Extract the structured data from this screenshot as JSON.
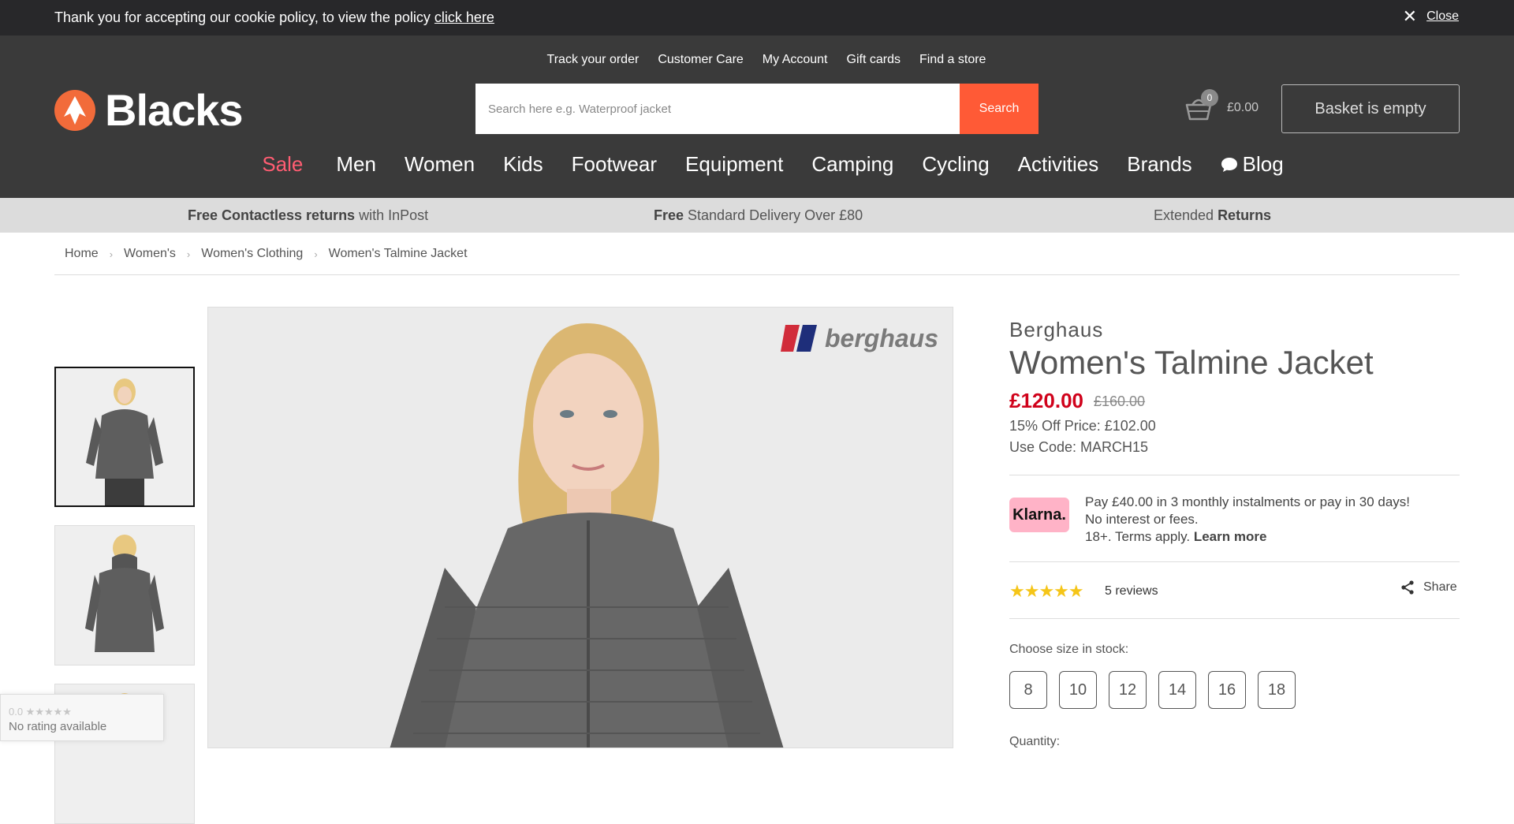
{
  "cookie": {
    "text": "Thank you for accepting our cookie policy, to view the policy ",
    "link": "click here",
    "close": "Close"
  },
  "util_nav": [
    "Track your order",
    "Customer Care",
    "My Account",
    "Gift cards",
    "Find a store"
  ],
  "logo": {
    "text": "Blacks"
  },
  "search": {
    "placeholder": "Search here e.g. Waterproof jacket",
    "button": "Search"
  },
  "basket": {
    "count": "0",
    "total": "£0.00",
    "status": "Basket is empty"
  },
  "main_nav": [
    "Sale",
    "Men",
    "Women",
    "Kids",
    "Footwear",
    "Equipment",
    "Camping",
    "Cycling",
    "Activities",
    "Brands",
    "Blog"
  ],
  "promo": {
    "p1_bold": "Free Contactless returns",
    "p1_rest": " with InPost",
    "p2_bold": "Free",
    "p2_rest": " Standard Delivery Over £80",
    "p3_rest": "Extended ",
    "p3_bold": "Returns"
  },
  "breadcrumb": [
    "Home",
    "Women's",
    "Women's Clothing",
    "Women's Talmine Jacket"
  ],
  "gallery": {
    "brand_logo": "berghaus"
  },
  "rating_badge": {
    "stars": "0.0 ★★★★★",
    "text": "No rating available"
  },
  "product": {
    "brand": "Berghaus",
    "title": "Women's Talmine Jacket",
    "price": "£120.00",
    "was_price": "£160.00",
    "offer": "15% Off Price: £102.00",
    "code": "Use Code: MARCH15"
  },
  "klarna": {
    "logo": "Klarna.",
    "line1": "Pay £40.00 in 3 monthly instalments or pay in 30 days!",
    "line2": "No interest or fees.",
    "line3": "18+. Terms apply. ",
    "learn_more": "Learn more"
  },
  "reviews": {
    "stars": "★★★★★",
    "rating": 5,
    "count_text": "5 reviews",
    "share": "Share"
  },
  "sizes": {
    "label": "Choose size in stock:",
    "options": [
      "8",
      "10",
      "12",
      "14",
      "16",
      "18"
    ]
  },
  "quantity": {
    "label": "Quantity:"
  },
  "colors": {
    "header": "#3a3a3a",
    "accent": "#ff5a36",
    "sale": "#ff5d72",
    "price": "#d0021b",
    "klarna": "#ffb3c7"
  }
}
